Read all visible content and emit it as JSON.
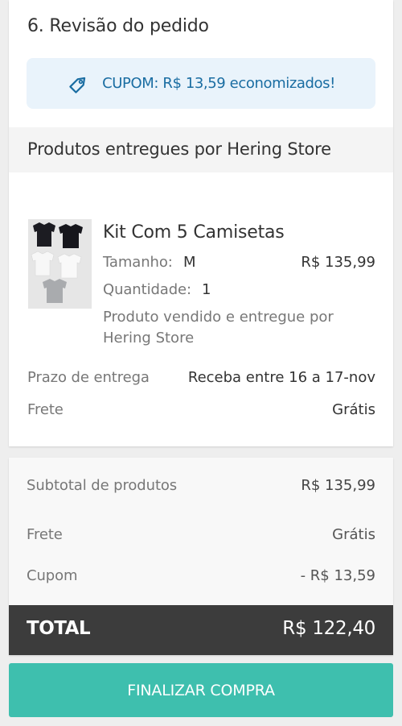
{
  "review": {
    "title": "6. Revisão do pedido",
    "coupon_icon": "tag-icon",
    "coupon_text": "CUPOM: R$ 13,59 economizados!",
    "store_heading": "Produtos entregues por Hering Store"
  },
  "product": {
    "name": "Kit Com 5 Camisetas",
    "size_label": "Tamanho:",
    "size_value": "M",
    "price": "R$ 135,99",
    "quantity_label": "Quantidade:",
    "quantity_value": "1",
    "sold_by": "Produto vendido e entregue por Hering Store",
    "delivery_label": "Prazo de entrega",
    "delivery_value": "Receba entre 16 a 17-nov",
    "shipping_label": "Frete",
    "shipping_value": "Grátis"
  },
  "summary": {
    "subtotal_label": "Subtotal de produtos",
    "subtotal_value": "R$ 135,99",
    "shipping_label": "Frete",
    "shipping_value": "Grátis",
    "coupon_label": "Cupom",
    "coupon_value": "- R$ 13,59",
    "total_label": "TOTAL",
    "total_value": "R$ 122,40"
  },
  "checkout": {
    "button_label": "FINALIZAR COMPRA"
  },
  "colors": {
    "accent": "#3ebfae",
    "coupon_text": "#1a6da2",
    "coupon_bg": "#e9f3fb",
    "total_bar": "#3c3c3c"
  }
}
